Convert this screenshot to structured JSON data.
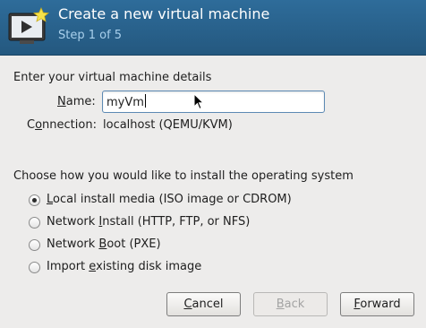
{
  "header": {
    "title": "Create a new virtual machine",
    "step": "Step 1 of 5"
  },
  "details": {
    "heading": "Enter your virtual machine details",
    "name_label": "Name:",
    "name_value": "myVm",
    "connection_label": "Connection:",
    "connection_value": "localhost (QEMU/KVM)"
  },
  "install": {
    "heading": "Choose how you would like to install the operating system",
    "options": [
      {
        "label": "Local install media (ISO image or CDROM)",
        "checked": true
      },
      {
        "label": "Network Install (HTTP, FTP, or NFS)",
        "checked": false
      },
      {
        "label": "Network Boot (PXE)",
        "checked": false
      },
      {
        "label": "Import existing disk image",
        "checked": false
      }
    ]
  },
  "buttons": {
    "cancel": "Cancel",
    "back": "Back",
    "forward": "Forward"
  },
  "icons": {
    "app": "virtual-machine-icon",
    "cursor": "mouse-pointer-icon"
  }
}
